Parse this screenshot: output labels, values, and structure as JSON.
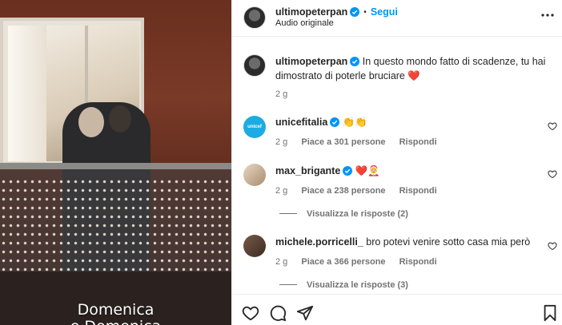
{
  "media": {
    "caption_line1": "Domenica",
    "caption_line2": "e Domenica"
  },
  "header": {
    "username": "ultimopeterpan",
    "follow_label": "Segui",
    "subtitle": "Audio originale",
    "dot": "•"
  },
  "post": {
    "username": "ultimopeterpan",
    "caption": "In questo mondo fatto di scadenze, tu hai dimostrato di poterle bruciare",
    "emoji": "❤️",
    "time": "2 g"
  },
  "comments": [
    {
      "username": "unicefitalia",
      "avatar_text": "unicef",
      "text": "👏👏",
      "time": "2 g",
      "likes": "Piace a 301 persone",
      "reply_label": "Rispondi"
    },
    {
      "username": "max_brigante",
      "text": "❤️🤶",
      "time": "2 g",
      "likes": "Piace a 238 persone",
      "reply_label": "Rispondi",
      "view_replies": "Visualizza le risposte (2)"
    },
    {
      "username": "michele.porricelli_",
      "text": "bro potevi venire sotto casa mia però",
      "time": "2 g",
      "likes": "Piace a 366 persone",
      "reply_label": "Rispondi",
      "view_replies": "Visualizza le risposte (3)"
    }
  ],
  "colors": {
    "accent": "#0095f6",
    "verified": "#0095f6",
    "text": "#262626",
    "muted": "#737373",
    "divider": "#efefef"
  },
  "icons": {
    "verified": "verified-badge-icon",
    "more": "more-options-icon",
    "like": "heart-icon",
    "comment": "comment-icon",
    "share": "share-icon",
    "save": "bookmark-icon"
  }
}
